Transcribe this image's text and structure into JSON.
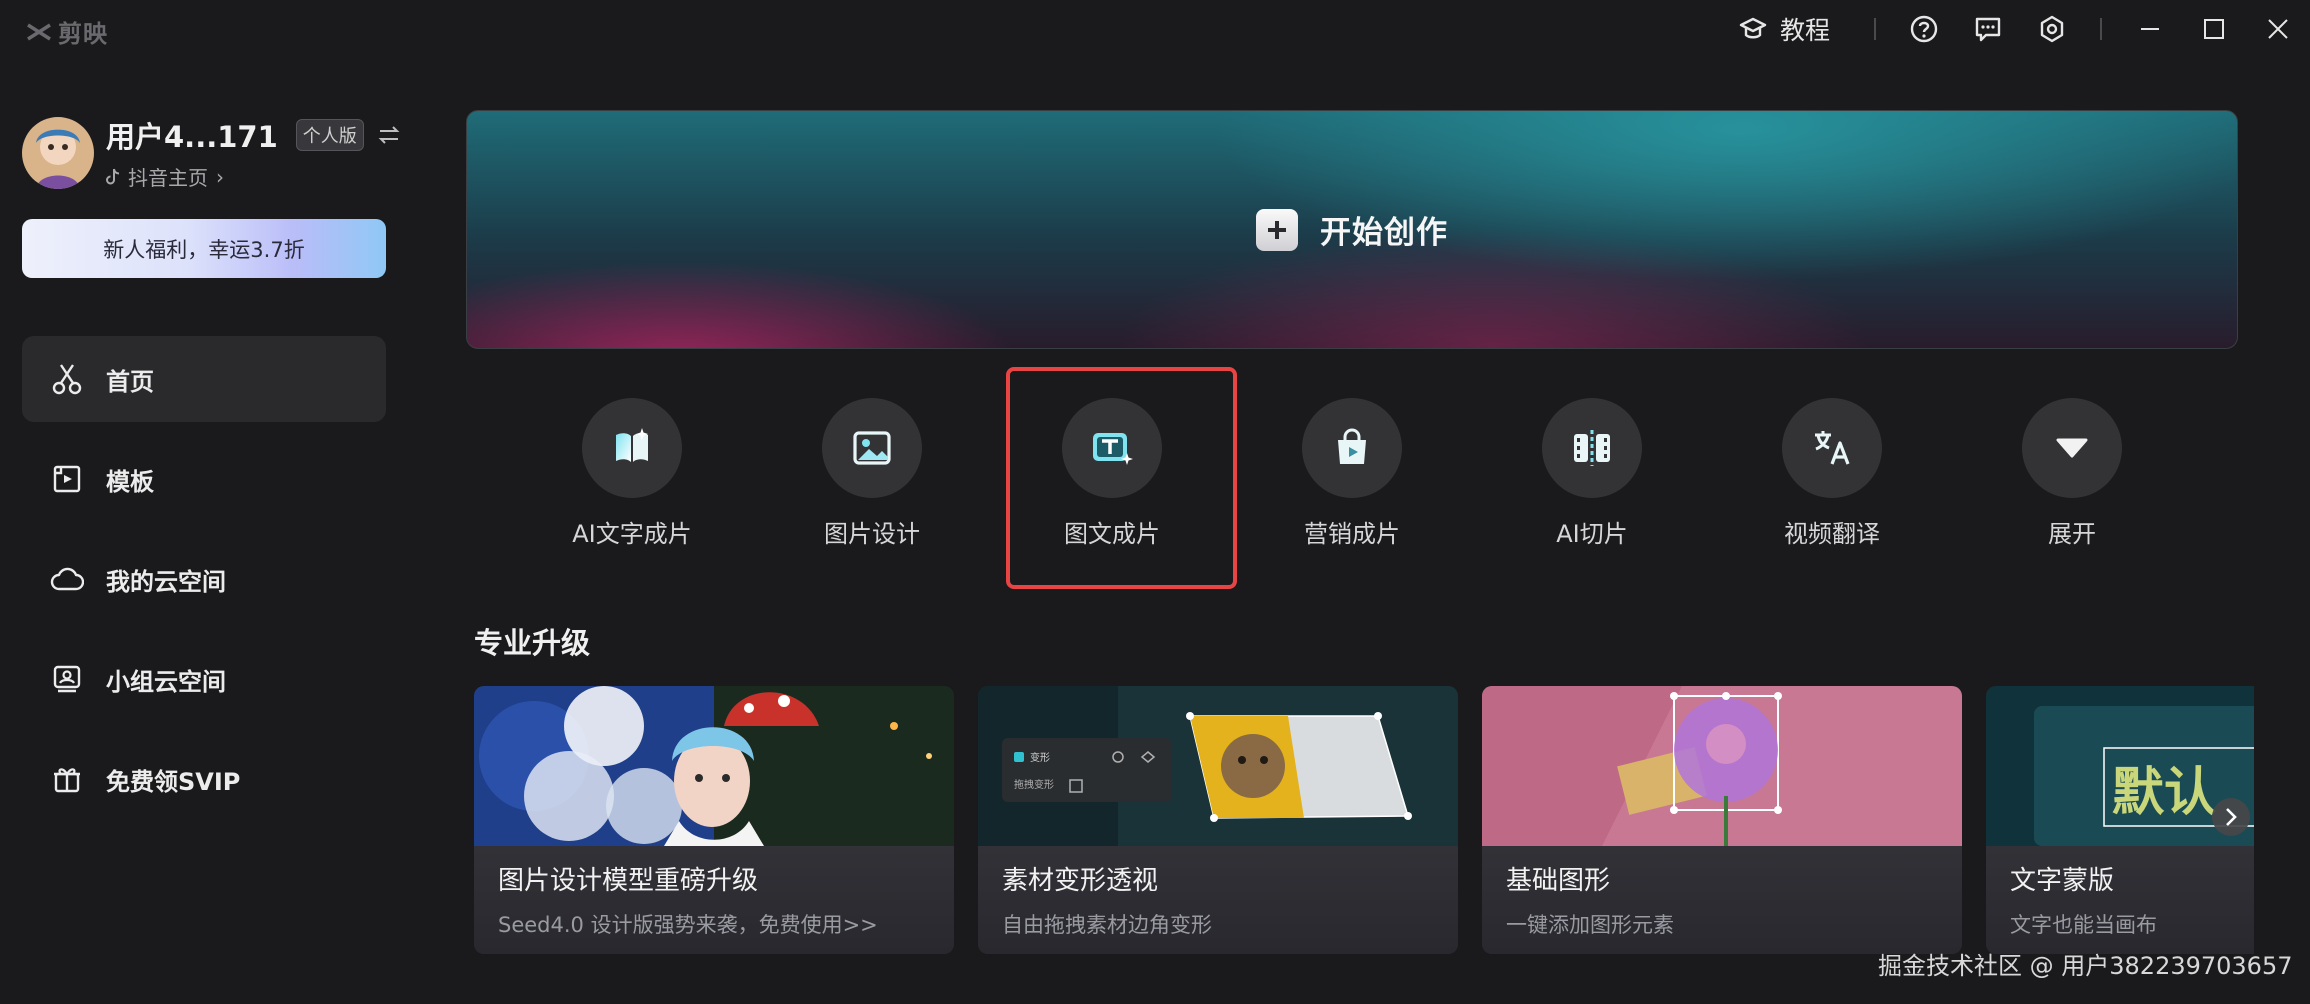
{
  "app": {
    "logo_text": "剪映"
  },
  "titlebar": {
    "tutorial_label": "教程"
  },
  "profile": {
    "username": "用户4...171",
    "edition_badge": "个人版",
    "douyin_link": "抖音主页"
  },
  "promo_banner": {
    "text": "新人福利，幸运3.7折"
  },
  "nav": {
    "items": [
      {
        "label": "首页",
        "icon": "scissors-icon",
        "active": true
      },
      {
        "label": "模板",
        "icon": "template-icon"
      },
      {
        "label": "我的云空间",
        "icon": "cloud-icon"
      },
      {
        "label": "小组云空间",
        "icon": "group-cloud-icon"
      },
      {
        "label": "免费领SVIP",
        "icon": "gift-icon"
      }
    ]
  },
  "hero": {
    "label": "开始创作"
  },
  "tools": [
    {
      "label": "AI文字成片",
      "icon": "ai-text-video-icon"
    },
    {
      "label": "图片设计",
      "icon": "image-design-icon"
    },
    {
      "label": "图文成片",
      "icon": "text-image-video-icon",
      "highlighted": true
    },
    {
      "label": "营销成片",
      "icon": "marketing-video-icon"
    },
    {
      "label": "AI切片",
      "icon": "ai-clip-icon"
    },
    {
      "label": "视频翻译",
      "icon": "video-translate-icon"
    },
    {
      "label": "展开",
      "icon": "expand-icon"
    }
  ],
  "section": {
    "title": "专业升级"
  },
  "cards": [
    {
      "title": "图片设计模型重磅升级",
      "subtitle": "Seed4.0 设计版强势来袭，免费使用>>"
    },
    {
      "title": "素材变形透视",
      "subtitle": "自由拖拽素材边角变形",
      "panel_label_1": "变形",
      "panel_label_2": "拖拽变形"
    },
    {
      "title": "基础图形",
      "subtitle": "一键添加图形元素"
    },
    {
      "title": "文字蒙版",
      "subtitle": "文字也能当画布",
      "preview_text": "默认"
    }
  ],
  "watermark": "掘金技术社区 @ 用户382239703657",
  "colors": {
    "highlight_border": "#e84444",
    "background": "#1a1a1c",
    "tool_circle": "#333336"
  }
}
